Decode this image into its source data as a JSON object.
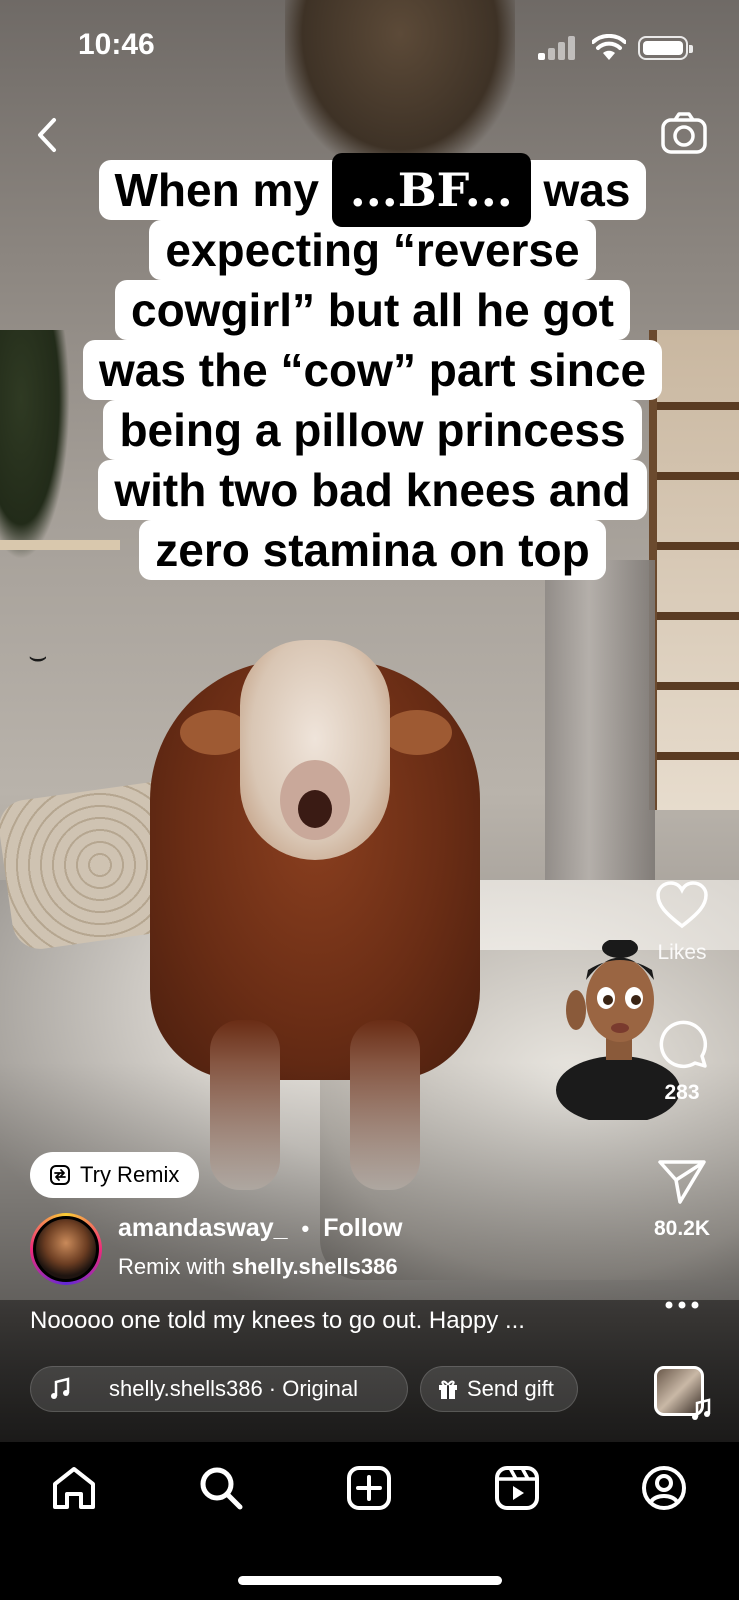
{
  "status_bar": {
    "time": "10:46"
  },
  "caption": {
    "line1_before": "When my",
    "line1_highlight": "...BF...",
    "line1_after": "was",
    "lines": [
      "expecting “reverse",
      "cowgirl” but all he got",
      "was the “cow” part since",
      "being a pillow princess",
      "with two bad knees and",
      "zero stamina on top"
    ]
  },
  "actions": {
    "likes_label": "Likes",
    "comments_count": "283",
    "shares_count": "80.2K"
  },
  "remix_button": {
    "label": "Try Remix"
  },
  "author": {
    "username": "amandasway_",
    "separator": "•",
    "follow_label": "Follow",
    "remix_prefix": "Remix with",
    "remix_user": "shelly.shells386"
  },
  "description": "Nooooo one told my knees to go out. Happy ...",
  "audio": {
    "label": "shelly.shells386 · Original"
  },
  "gift": {
    "label": "Send gift"
  },
  "nav": {
    "items": [
      "home-icon",
      "search-icon",
      "create-icon",
      "reels-icon",
      "profile-icon"
    ]
  },
  "colors": {
    "background": "#000000",
    "text": "#ffffff",
    "caption_bg": "#ffffff"
  }
}
